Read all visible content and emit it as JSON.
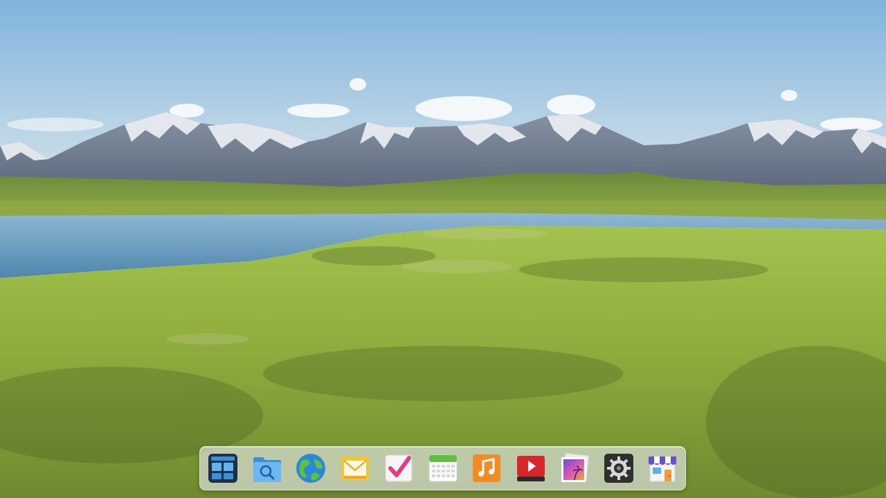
{
  "desktop": {
    "wallpaper": "mountain-lake-meadow",
    "colors": {
      "sky_top": "#7fb4dd",
      "sky_bottom": "#cfe0ec",
      "mountain": "#6f7d92",
      "snow": "#eef2f6",
      "lake": "#5f93b8",
      "grass_far": "#6f8f3e",
      "grass_near": "#8ab040"
    }
  },
  "dock": {
    "items": [
      {
        "name": "multitasking-view",
        "icon": "multitasking-icon",
        "color": "#2f6bb3"
      },
      {
        "name": "file-manager",
        "icon": "folder-search-icon",
        "color": "#5aa9ea"
      },
      {
        "name": "web-browser",
        "icon": "globe-icon",
        "color": "#3aa0e0"
      },
      {
        "name": "mail",
        "icon": "mail-envelope-icon",
        "color": "#f3c13a"
      },
      {
        "name": "todo",
        "icon": "checkmark-icon",
        "color": "#e0457b"
      },
      {
        "name": "calendar",
        "icon": "calendar-icon",
        "color": "#6cc24a"
      },
      {
        "name": "music-player",
        "icon": "music-note-icon",
        "color": "#f28a22"
      },
      {
        "name": "video-player",
        "icon": "play-icon",
        "color": "#d62a2a"
      },
      {
        "name": "photo-viewer",
        "icon": "photos-icon",
        "color": "#8a5ad6"
      },
      {
        "name": "system-settings",
        "icon": "gear-icon",
        "color": "#3c3c3c"
      },
      {
        "name": "app-store",
        "icon": "store-icon",
        "color": "#6b4fd0"
      }
    ]
  }
}
